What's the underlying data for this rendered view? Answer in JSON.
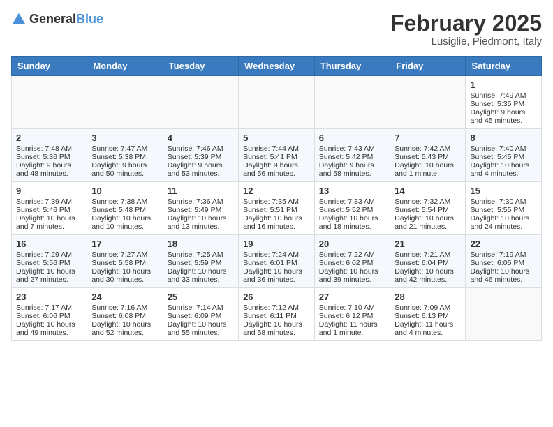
{
  "logo": {
    "general": "General",
    "blue": "Blue"
  },
  "title": "February 2025",
  "subtitle": "Lusiglie, Piedmont, Italy",
  "days_of_week": [
    "Sunday",
    "Monday",
    "Tuesday",
    "Wednesday",
    "Thursday",
    "Friday",
    "Saturday"
  ],
  "weeks": [
    [
      {
        "day": "",
        "info": ""
      },
      {
        "day": "",
        "info": ""
      },
      {
        "day": "",
        "info": ""
      },
      {
        "day": "",
        "info": ""
      },
      {
        "day": "",
        "info": ""
      },
      {
        "day": "",
        "info": ""
      },
      {
        "day": "1",
        "info": "Sunrise: 7:49 AM\nSunset: 5:35 PM\nDaylight: 9 hours and 45 minutes."
      }
    ],
    [
      {
        "day": "2",
        "info": "Sunrise: 7:48 AM\nSunset: 5:36 PM\nDaylight: 9 hours and 48 minutes."
      },
      {
        "day": "3",
        "info": "Sunrise: 7:47 AM\nSunset: 5:38 PM\nDaylight: 9 hours and 50 minutes."
      },
      {
        "day": "4",
        "info": "Sunrise: 7:46 AM\nSunset: 5:39 PM\nDaylight: 9 hours and 53 minutes."
      },
      {
        "day": "5",
        "info": "Sunrise: 7:44 AM\nSunset: 5:41 PM\nDaylight: 9 hours and 56 minutes."
      },
      {
        "day": "6",
        "info": "Sunrise: 7:43 AM\nSunset: 5:42 PM\nDaylight: 9 hours and 58 minutes."
      },
      {
        "day": "7",
        "info": "Sunrise: 7:42 AM\nSunset: 5:43 PM\nDaylight: 10 hours and 1 minute."
      },
      {
        "day": "8",
        "info": "Sunrise: 7:40 AM\nSunset: 5:45 PM\nDaylight: 10 hours and 4 minutes."
      }
    ],
    [
      {
        "day": "9",
        "info": "Sunrise: 7:39 AM\nSunset: 5:46 PM\nDaylight: 10 hours and 7 minutes."
      },
      {
        "day": "10",
        "info": "Sunrise: 7:38 AM\nSunset: 5:48 PM\nDaylight: 10 hours and 10 minutes."
      },
      {
        "day": "11",
        "info": "Sunrise: 7:36 AM\nSunset: 5:49 PM\nDaylight: 10 hours and 13 minutes."
      },
      {
        "day": "12",
        "info": "Sunrise: 7:35 AM\nSunset: 5:51 PM\nDaylight: 10 hours and 16 minutes."
      },
      {
        "day": "13",
        "info": "Sunrise: 7:33 AM\nSunset: 5:52 PM\nDaylight: 10 hours and 18 minutes."
      },
      {
        "day": "14",
        "info": "Sunrise: 7:32 AM\nSunset: 5:54 PM\nDaylight: 10 hours and 21 minutes."
      },
      {
        "day": "15",
        "info": "Sunrise: 7:30 AM\nSunset: 5:55 PM\nDaylight: 10 hours and 24 minutes."
      }
    ],
    [
      {
        "day": "16",
        "info": "Sunrise: 7:29 AM\nSunset: 5:56 PM\nDaylight: 10 hours and 27 minutes."
      },
      {
        "day": "17",
        "info": "Sunrise: 7:27 AM\nSunset: 5:58 PM\nDaylight: 10 hours and 30 minutes."
      },
      {
        "day": "18",
        "info": "Sunrise: 7:25 AM\nSunset: 5:59 PM\nDaylight: 10 hours and 33 minutes."
      },
      {
        "day": "19",
        "info": "Sunrise: 7:24 AM\nSunset: 6:01 PM\nDaylight: 10 hours and 36 minutes."
      },
      {
        "day": "20",
        "info": "Sunrise: 7:22 AM\nSunset: 6:02 PM\nDaylight: 10 hours and 39 minutes."
      },
      {
        "day": "21",
        "info": "Sunrise: 7:21 AM\nSunset: 6:04 PM\nDaylight: 10 hours and 42 minutes."
      },
      {
        "day": "22",
        "info": "Sunrise: 7:19 AM\nSunset: 6:05 PM\nDaylight: 10 hours and 46 minutes."
      }
    ],
    [
      {
        "day": "23",
        "info": "Sunrise: 7:17 AM\nSunset: 6:06 PM\nDaylight: 10 hours and 49 minutes."
      },
      {
        "day": "24",
        "info": "Sunrise: 7:16 AM\nSunset: 6:08 PM\nDaylight: 10 hours and 52 minutes."
      },
      {
        "day": "25",
        "info": "Sunrise: 7:14 AM\nSunset: 6:09 PM\nDaylight: 10 hours and 55 minutes."
      },
      {
        "day": "26",
        "info": "Sunrise: 7:12 AM\nSunset: 6:11 PM\nDaylight: 10 hours and 58 minutes."
      },
      {
        "day": "27",
        "info": "Sunrise: 7:10 AM\nSunset: 6:12 PM\nDaylight: 11 hours and 1 minute."
      },
      {
        "day": "28",
        "info": "Sunrise: 7:09 AM\nSunset: 6:13 PM\nDaylight: 11 hours and 4 minutes."
      },
      {
        "day": "",
        "info": ""
      }
    ]
  ]
}
